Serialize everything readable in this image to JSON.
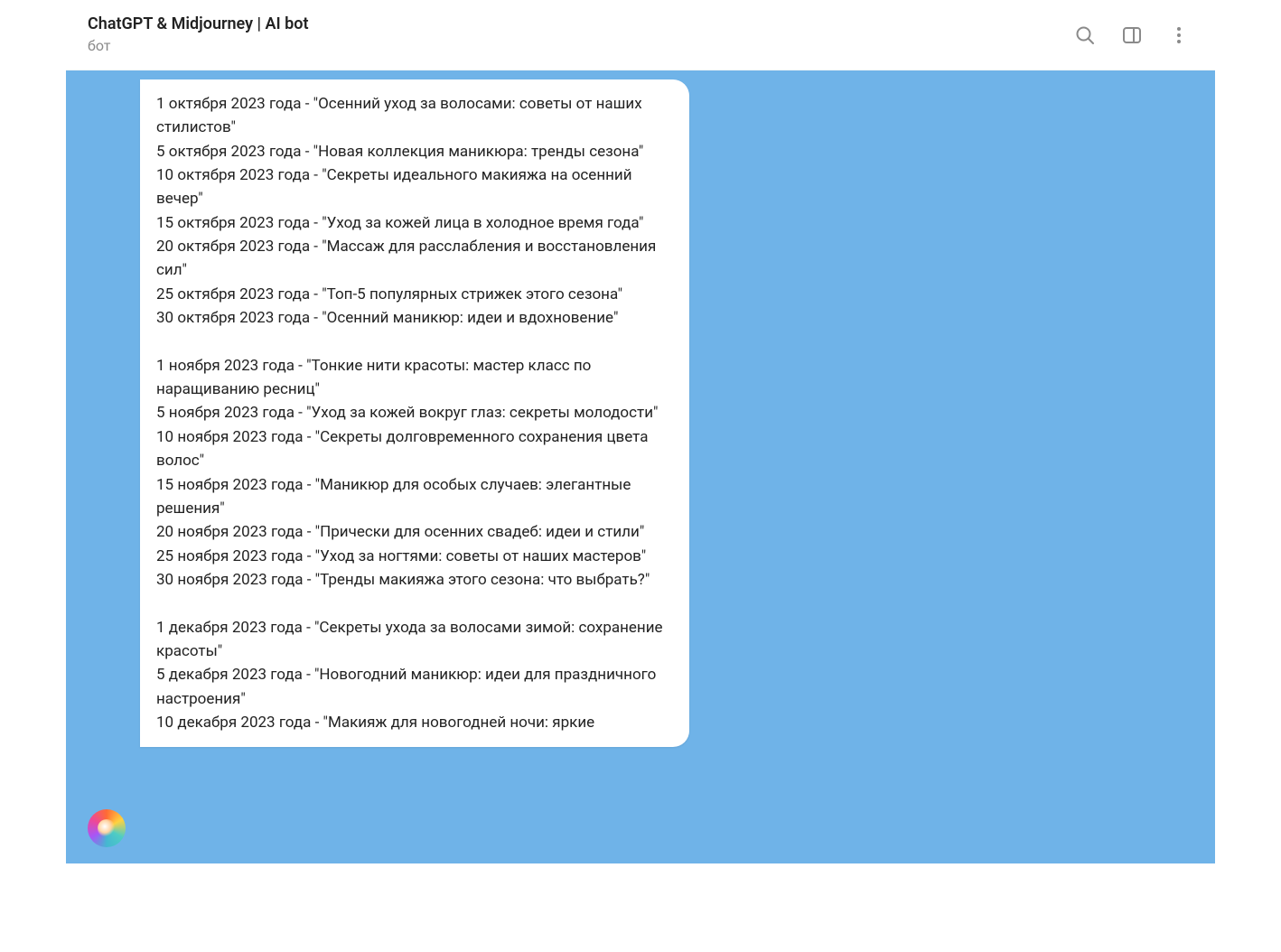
{
  "header": {
    "title": "ChatGPT & Midjourney | AI bot",
    "subtitle": "бот"
  },
  "message": {
    "text": "1 октября 2023 года - \"Осенний уход за волосами: советы от наших стилистов\"\n5 октября 2023 года - \"Новая коллекция маникюра: тренды сезона\"\n10 октября 2023 года - \"Секреты идеального макияжа на осенний вечер\"\n15 октября 2023 года - \"Уход за кожей лица в холодное время года\"\n20 октября 2023 года - \"Массаж для расслабления и восстановления сил\"\n25 октября 2023 года - \"Топ-5 популярных стрижек этого сезона\"\n30 октября 2023 года - \"Осенний маникюр: идеи и вдохновение\"\n\n1 ноября 2023 года - \"Тонкие нити красоты: мастер класс по наращиванию ресниц\"\n5 ноября 2023 года - \"Уход за кожей вокруг глаз: секреты молодости\"\n10 ноября 2023 года - \"Секреты долговременного сохранения цвета волос\"\n15 ноября 2023 года - \"Маникюр для особых случаев: элегантные решения\"\n20 ноября 2023 года - \"Прически для осенних свадеб: идеи и стили\"\n25 ноября 2023 года - \"Уход за ногтями: советы от наших мастеров\"\n30 ноября 2023 года - \"Тренды макияжа этого сезона: что выбрать?\"\n\n1 декабря 2023 года - \"Секреты ухода за волосами зимой: сохранение красоты\"\n5 декабря 2023 года - \"Новогодний маникюр: идеи для праздничного настроения\"\n10 декабря 2023 года - \"Макияж для новогодней ночи: яркие"
  }
}
